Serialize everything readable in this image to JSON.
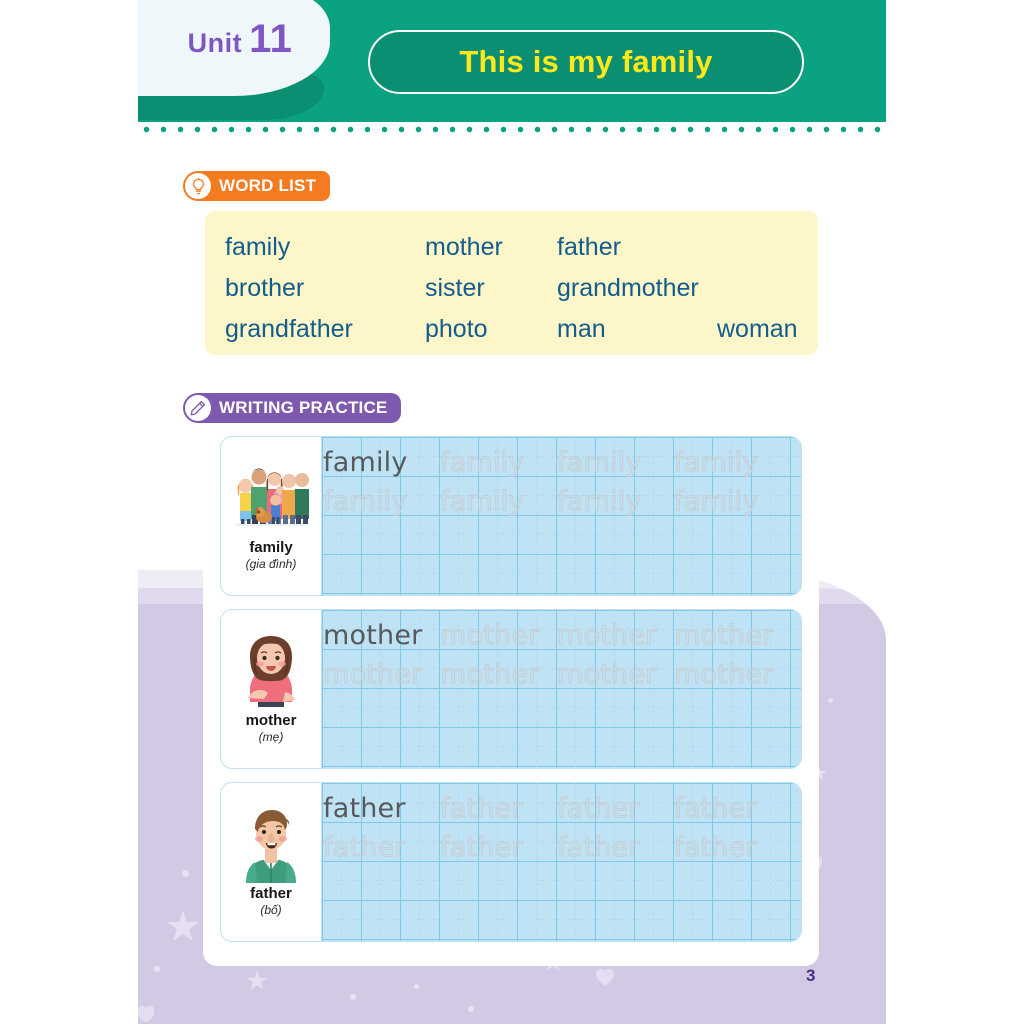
{
  "header": {
    "unit_label": "Unit",
    "unit_number": "11",
    "title": "This is my family",
    "green": "#0aa281",
    "title_color": "#ffe81a",
    "unit_color": "#7e57c2"
  },
  "word_list": {
    "badge_label": "WORD LIST",
    "badge_icon": "lightbulb-icon",
    "badge_color": "#f47b20",
    "box_color": "#fdf6c8",
    "text_color": "#135c8d",
    "rows": [
      [
        "family",
        "mother",
        "father"
      ],
      [
        "brother",
        "sister",
        "grandmother"
      ],
      [
        "grandfather",
        "photo",
        "man",
        "woman"
      ]
    ]
  },
  "writing_practice": {
    "badge_label": "WRITING PRACTICE",
    "badge_icon": "pencil-icon",
    "badge_color": "#7e5aae",
    "rows": [
      {
        "en": "family",
        "vi": "(gia đình)",
        "image": "family-group-illustration",
        "line1": [
          "family",
          "family",
          "family",
          "family"
        ],
        "line2": [
          "family",
          "family",
          "family",
          "family"
        ]
      },
      {
        "en": "mother",
        "vi": "(mẹ)",
        "image": "mother-illustration",
        "line1": [
          "mother",
          "mother",
          "mother",
          "mother"
        ],
        "line2": [
          "mother",
          "mother",
          "mother",
          "mother"
        ]
      },
      {
        "en": "father",
        "vi": "(bố)",
        "image": "father-illustration",
        "line1": [
          "father",
          "father",
          "father",
          "father"
        ],
        "line2": [
          "father",
          "father",
          "father",
          "father"
        ]
      }
    ]
  },
  "footer": {
    "page_number": "3",
    "page_number_color": "#4b2e83"
  }
}
